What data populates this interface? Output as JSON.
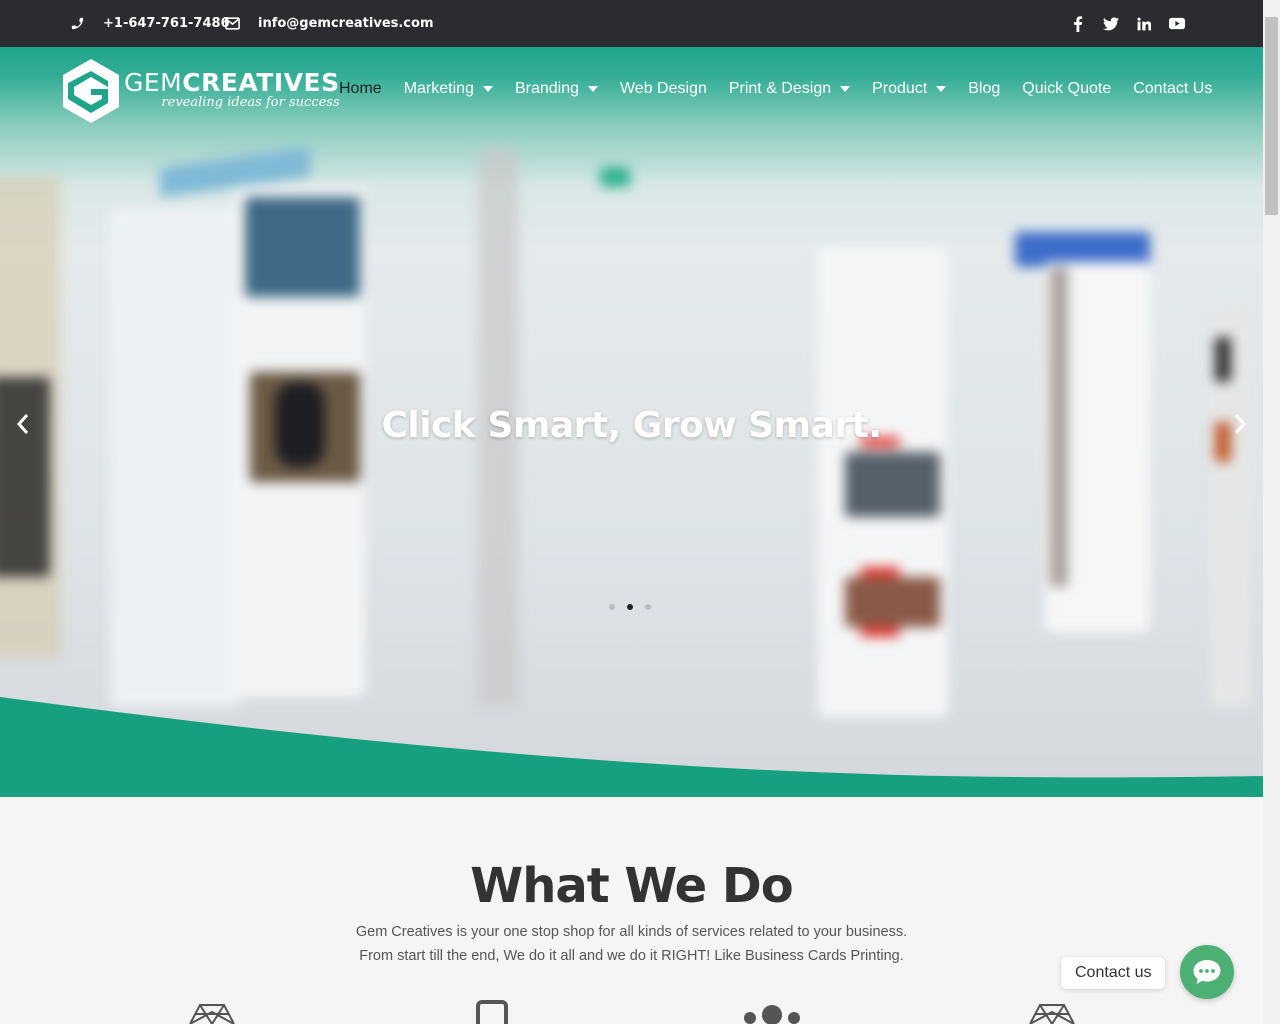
{
  "topbar": {
    "phone": "+1-647-761-7486",
    "email": "info@gemcreatives.com",
    "socials": [
      "facebook-icon",
      "twitter-icon",
      "linkedin-icon",
      "youtube-icon"
    ]
  },
  "logo": {
    "name_light": "GEM",
    "name_bold": "CREATIVES",
    "tagline": "revealing ideas for success"
  },
  "nav": {
    "items": [
      {
        "label": "Home",
        "active": true
      },
      {
        "label": "Marketing",
        "dropdown": true
      },
      {
        "label": "Branding",
        "dropdown": true
      },
      {
        "label": "Web Design"
      },
      {
        "label": "Print & Design",
        "dropdown": true
      },
      {
        "label": "Product",
        "dropdown": true
      },
      {
        "label": "Blog"
      },
      {
        "label": "Quick Quote"
      },
      {
        "label": "Contact Us"
      }
    ]
  },
  "hero": {
    "title": "Click Smart, Grow Smart.",
    "slides_total": 3,
    "active_slide": 2
  },
  "what_we_do": {
    "title": "What We Do",
    "line1": "Gem Creatives is your one stop shop for all kinds of services related to your business.",
    "line2": "From start till the end, We do it all and we do it RIGHT! Like Business Cards Printing."
  },
  "contact_widget": {
    "label": "Contact us"
  },
  "colors": {
    "brand": "#1fa58a",
    "topbar": "#2b2c30",
    "widget": "#4caf73"
  }
}
